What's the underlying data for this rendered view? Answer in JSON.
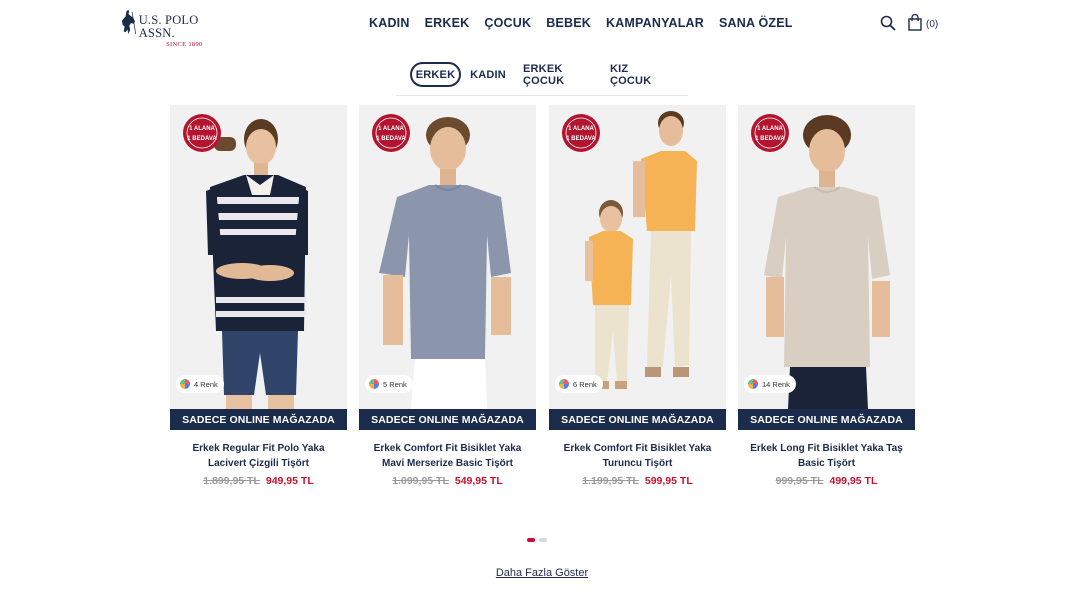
{
  "brand": {
    "name": "U.S. POLO ASSN.",
    "since": "SINCE 1890"
  },
  "nav": [
    "KADIN",
    "ERKEK",
    "ÇOCUK",
    "BEBEK",
    "KAMPANYALAR",
    "SANA ÖZEL"
  ],
  "cart": {
    "count": "(0)"
  },
  "tabs": [
    "ERKEK",
    "KADIN",
    "ERKEK ÇOCUK",
    "KIZ ÇOCUK"
  ],
  "active_tab": "ERKEK",
  "badge": {
    "line1": "1 ALANA",
    "line2": "1 BEDAVA"
  },
  "products": [
    {
      "colors": "4 Renk",
      "banner": "SADECE ONLINE MAĞAZADA",
      "name": "Erkek Regular Fit Polo Yaka Lacivert Çizgili Tişört",
      "old_price": "1.899,95 TL",
      "new_price": "949,95 TL"
    },
    {
      "colors": "5 Renk",
      "banner": "SADECE ONLINE MAĞAZADA",
      "name": "Erkek Comfort Fit Bisiklet Yaka Mavi Merserize Basic Tişört",
      "old_price": "1.099,95 TL",
      "new_price": "549,95 TL"
    },
    {
      "colors": "6 Renk",
      "banner": "SADECE ONLINE MAĞAZADA",
      "name": "Erkek Comfort Fit Bisiklet Yaka Turuncu Tişört",
      "old_price": "1.199,95 TL",
      "new_price": "599,95 TL"
    },
    {
      "colors": "14 Renk",
      "banner": "SADECE ONLINE MAĞAZADA",
      "name": "Erkek Long Fit Bisiklet Yaka Taş Basic Tişört",
      "old_price": "999,95 TL",
      "new_price": "499,95 TL"
    }
  ],
  "carousel": {
    "pages": 2,
    "current": 1
  },
  "show_more": "Daha Fazla Göster",
  "colors": {
    "navy": "#1b2b4b",
    "sale_red": "#c8102e",
    "badge_red": "#b3142e"
  }
}
